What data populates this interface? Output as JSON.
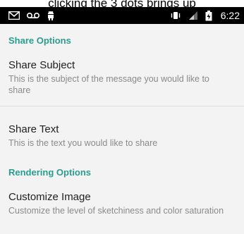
{
  "caption": {
    "text": "clicking the 3 dots brings up"
  },
  "status_bar": {
    "time": "6:22",
    "left_icons": [
      "gmail-icon",
      "voicemail-icon",
      "android-icon"
    ],
    "right_icons": [
      "vibrate-icon",
      "signal-icon",
      "battery-icon"
    ]
  },
  "settings": {
    "share_options_header": "Share Options",
    "share_subject": {
      "title": "Share Subject",
      "summary": "This is the subject of the message you would like to share"
    },
    "share_text": {
      "title": "Share Text",
      "summary": "This is the text you would like to share"
    },
    "rendering_options_header": "Rendering Options",
    "customize_image": {
      "title": "Customize Image",
      "summary": "Customize the level of sketchiness and color saturation"
    }
  },
  "colors": {
    "accent": "#2a9d8f",
    "background": "#f3f3f3",
    "status_bar": "#000000"
  }
}
